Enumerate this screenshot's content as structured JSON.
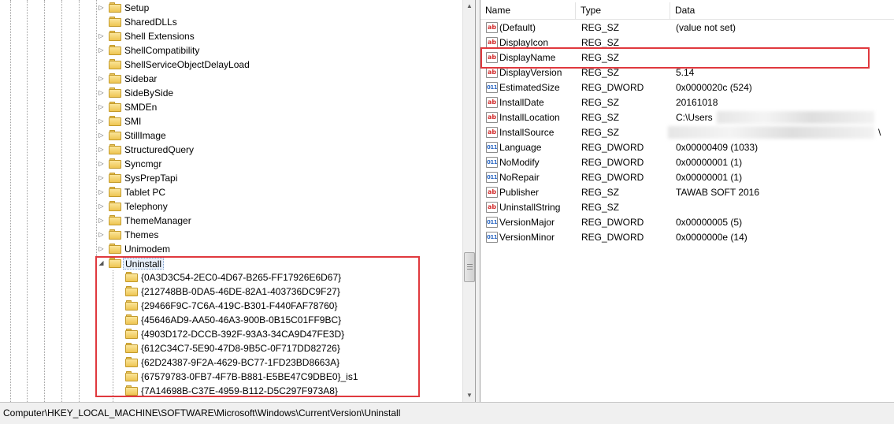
{
  "tree": {
    "items": [
      {
        "label": "Setup",
        "expander": "▷",
        "level": 0
      },
      {
        "label": "SharedDLLs",
        "expander": "",
        "level": 0
      },
      {
        "label": "Shell Extensions",
        "expander": "▷",
        "level": 0
      },
      {
        "label": "ShellCompatibility",
        "expander": "▷",
        "level": 0
      },
      {
        "label": "ShellServiceObjectDelayLoad",
        "expander": "",
        "level": 0
      },
      {
        "label": "Sidebar",
        "expander": "▷",
        "level": 0
      },
      {
        "label": "SideBySide",
        "expander": "▷",
        "level": 0
      },
      {
        "label": "SMDEn",
        "expander": "▷",
        "level": 0
      },
      {
        "label": "SMI",
        "expander": "▷",
        "level": 0
      },
      {
        "label": "StillImage",
        "expander": "▷",
        "level": 0
      },
      {
        "label": "StructuredQuery",
        "expander": "▷",
        "level": 0
      },
      {
        "label": "Syncmgr",
        "expander": "▷",
        "level": 0
      },
      {
        "label": "SysPrepTapi",
        "expander": "▷",
        "level": 0
      },
      {
        "label": "Tablet PC",
        "expander": "▷",
        "level": 0
      },
      {
        "label": "Telephony",
        "expander": "▷",
        "level": 0
      },
      {
        "label": "ThemeManager",
        "expander": "▷",
        "level": 0
      },
      {
        "label": "Themes",
        "expander": "▷",
        "level": 0
      },
      {
        "label": "Unimodem",
        "expander": "▷",
        "level": 0
      },
      {
        "label": "Uninstall",
        "expander": "◢",
        "level": 0,
        "selected": true
      },
      {
        "label": "{0A3D3C54-2EC0-4D67-B265-FF17926E6D67}",
        "expander": "",
        "level": 1
      },
      {
        "label": "{212748BB-0DA5-46DE-82A1-403736DC9F27}",
        "expander": "",
        "level": 1
      },
      {
        "label": "{29466F9C-7C6A-419C-B301-F440FAF78760}",
        "expander": "",
        "level": 1
      },
      {
        "label": "{45646AD9-AA50-46A3-900B-0B15C01FF9BC}",
        "expander": "",
        "level": 1
      },
      {
        "label": "{4903D172-DCCB-392F-93A3-34CA9D47FE3D}",
        "expander": "",
        "level": 1
      },
      {
        "label": "{612C34C7-5E90-47D8-9B5C-0F717DD82726}",
        "expander": "",
        "level": 1
      },
      {
        "label": "{62D24387-9F2A-4629-BC77-1FD23BD8663A}",
        "expander": "",
        "level": 1
      },
      {
        "label": "{67579783-0FB7-4F7B-B881-E5BE47C9DBE0}_is1",
        "expander": "",
        "level": 1
      },
      {
        "label": "{7A14698B-C37E-4959-B112-D5C297F973A8}",
        "expander": "",
        "level": 1
      }
    ]
  },
  "list": {
    "columns": {
      "name": "Name",
      "type": "Type",
      "data": "Data"
    },
    "rows": [
      {
        "name": "(Default)",
        "type": "REG_SZ",
        "data": "(value not set)",
        "icon": "ab"
      },
      {
        "name": "DisplayIcon",
        "type": "REG_SZ",
        "data": "",
        "icon": "ab"
      },
      {
        "name": "DisplayName",
        "type": "REG_SZ",
        "data": "",
        "icon": "ab"
      },
      {
        "name": "DisplayVersion",
        "type": "REG_SZ",
        "data": "5.14",
        "icon": "ab"
      },
      {
        "name": "EstimatedSize",
        "type": "REG_DWORD",
        "data": "0x0000020c (524)",
        "icon": "bin"
      },
      {
        "name": "InstallDate",
        "type": "REG_SZ",
        "data": "20161018",
        "icon": "ab"
      },
      {
        "name": "InstallLocation",
        "type": "REG_SZ",
        "data": "C:\\Users",
        "icon": "ab"
      },
      {
        "name": "InstallSource",
        "type": "REG_SZ",
        "data": "",
        "icon": "ab",
        "tail": "\\"
      },
      {
        "name": "Language",
        "type": "REG_DWORD",
        "data": "0x00000409 (1033)",
        "icon": "bin"
      },
      {
        "name": "NoModify",
        "type": "REG_DWORD",
        "data": "0x00000001 (1)",
        "icon": "bin"
      },
      {
        "name": "NoRepair",
        "type": "REG_DWORD",
        "data": "0x00000001 (1)",
        "icon": "bin"
      },
      {
        "name": "Publisher",
        "type": "REG_SZ",
        "data": "TAWAB SOFT 2016",
        "icon": "ab"
      },
      {
        "name": "UninstallString",
        "type": "REG_SZ",
        "data": "",
        "icon": "ab"
      },
      {
        "name": "VersionMajor",
        "type": "REG_DWORD",
        "data": "0x00000005 (5)",
        "icon": "bin"
      },
      {
        "name": "VersionMinor",
        "type": "REG_DWORD",
        "data": "0x0000000e (14)",
        "icon": "bin"
      }
    ]
  },
  "status_bar": {
    "path": "Computer\\HKEY_LOCAL_MACHINE\\SOFTWARE\\Microsoft\\Windows\\CurrentVersion\\Uninstall"
  },
  "colors": {
    "highlight_box": "#e0393e",
    "folder": "#eec552"
  },
  "icons": {
    "string_value": "ab",
    "binary_value": "011"
  }
}
